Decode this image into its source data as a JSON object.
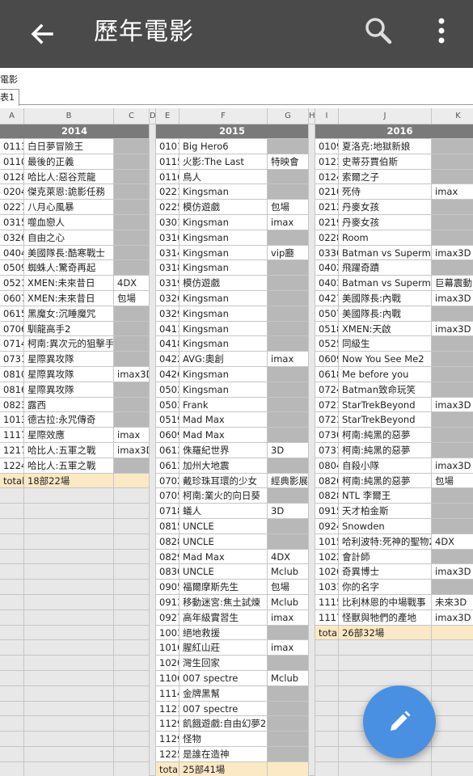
{
  "app_bar": {
    "title": "歷年電影",
    "back_icon": "arrow-left-icon",
    "search_icon": "search-icon",
    "more_icon": "more-vert-icon",
    "background": "#4a4a4a"
  },
  "sheet": {
    "name": "電影",
    "tab": "表1"
  },
  "fab": {
    "icon": "pencil-icon",
    "color": "#4a90e2"
  },
  "columns": [
    "A",
    "B",
    "C",
    "D",
    "E",
    "F",
    "G",
    "H",
    "I",
    "J",
    "K"
  ],
  "years": [
    "2014",
    "2015",
    "2016"
  ],
  "blocks": [
    {
      "rows": [
        [
          "0113",
          "白日夢冒險王",
          ""
        ],
        [
          "0110",
          "最後的正義",
          ""
        ],
        [
          "0128",
          "哈比人:惡谷荒龍",
          ""
        ],
        [
          "0204",
          "傑克萊恩:詭影任務",
          ""
        ],
        [
          "0227",
          "八月心風暴",
          ""
        ],
        [
          "0315",
          "噬血戀人",
          ""
        ],
        [
          "0326",
          "自由之心",
          ""
        ],
        [
          "0404",
          "美國隊長:酷寒戰士",
          ""
        ],
        [
          "0509",
          "蜘蛛人:驚奇再起",
          ""
        ],
        [
          "0521",
          "XMEN:未來昔日",
          "4DX"
        ],
        [
          "0607",
          "XMEN:未來昔日",
          "包場"
        ],
        [
          "0615",
          "黑魔女:沉睡魔咒",
          ""
        ],
        [
          "0706",
          "馴龍高手2",
          ""
        ],
        [
          "0714",
          "柯南:異次元的狙擊手",
          ""
        ],
        [
          "0731",
          "星際異攻隊",
          ""
        ],
        [
          "0810",
          "星際異攻隊",
          "imax3D"
        ],
        [
          "0816",
          "星際異攻隊",
          ""
        ],
        [
          "0823",
          "露西",
          ""
        ],
        [
          "1013",
          "德古拉:永咒傳奇",
          ""
        ],
        [
          "1117",
          "星際效應",
          "imax"
        ],
        [
          "1217",
          "哈比人:五軍之戰",
          "imax3D"
        ],
        [
          "1224",
          "哈比人:五軍之戰",
          ""
        ]
      ],
      "total": [
        "total",
        "18部22場",
        ""
      ]
    },
    {
      "rows": [
        [
          "0101",
          "Big Hero6",
          ""
        ],
        [
          "0115",
          "火影:The Last",
          "特映會"
        ],
        [
          "0116",
          "鳥人",
          ""
        ],
        [
          "0221",
          "Kingsman",
          ""
        ],
        [
          "0225",
          "模仿遊戲",
          "包場"
        ],
        [
          "0301",
          "Kingsman",
          "imax"
        ],
        [
          "0310",
          "Kingsman",
          ""
        ],
        [
          "0314",
          "Kingsman",
          "vip廳"
        ],
        [
          "0318",
          "Kingsman",
          ""
        ],
        [
          "0319",
          "模仿遊戲",
          ""
        ],
        [
          "0326",
          "Kingsman",
          ""
        ],
        [
          "0329",
          "Kingsman",
          ""
        ],
        [
          "0411",
          "Kingsman",
          ""
        ],
        [
          "0418",
          "Kingsman",
          ""
        ],
        [
          "0422",
          "AVG:奧創",
          "imax"
        ],
        [
          "0426",
          "Kingsman",
          ""
        ],
        [
          "0503",
          "Kingsman",
          ""
        ],
        [
          "0503",
          "Frank",
          ""
        ],
        [
          "0519",
          "Mad Max",
          ""
        ],
        [
          "0609",
          "Mad Max",
          ""
        ],
        [
          "0613",
          "侏羅紀世界",
          "3D"
        ],
        [
          "0613",
          "加州大地震",
          ""
        ],
        [
          "0702",
          "戴珍珠耳環的少女",
          "經典影展"
        ],
        [
          "0705",
          "柯南:業火的向日葵",
          ""
        ],
        [
          "0718",
          "蟻人",
          "3D"
        ],
        [
          "0815",
          "UNCLE",
          ""
        ],
        [
          "0828",
          "UNCLE",
          ""
        ],
        [
          "0829",
          "Mad Max",
          "4DX"
        ],
        [
          "0830",
          "UNCLE",
          "Mclub"
        ],
        [
          "0905",
          "福爾摩斯先生",
          "包場"
        ],
        [
          "0913",
          "移動迷宮:焦土試煉",
          "Mclub"
        ],
        [
          "0927",
          "高年級實習生",
          "imax"
        ],
        [
          "1003",
          "絕地救援",
          ""
        ],
        [
          "1016",
          "腥紅山莊",
          "imax"
        ],
        [
          "1020",
          "灣生回家",
          ""
        ],
        [
          "1106",
          "007 spectre",
          "Mclub"
        ],
        [
          "1114",
          "金牌黑幫",
          ""
        ],
        [
          "1121",
          "007 spectre",
          ""
        ],
        [
          "1129",
          "飢餓遊戲:自由幻夢2",
          ""
        ],
        [
          "1129",
          "怪物",
          ""
        ],
        [
          "1225",
          "是誰在造神",
          ""
        ]
      ],
      "total": [
        "total",
        "25部41場",
        ""
      ]
    },
    {
      "rows": [
        [
          "0109",
          "夏洛克:地獄新娘",
          ""
        ],
        [
          "0123",
          "史蒂芬賈伯斯",
          ""
        ],
        [
          "0124",
          "索爾之子",
          ""
        ],
        [
          "0210",
          "死侍",
          "imax"
        ],
        [
          "0212",
          "丹麥女孩",
          ""
        ],
        [
          "0219",
          "丹麥女孩",
          ""
        ],
        [
          "0228",
          "Room",
          ""
        ],
        [
          "0330",
          "Batman vs Superman",
          "imax3D"
        ],
        [
          "0402",
          "飛躍奇蹟",
          ""
        ],
        [
          "0403",
          "Batman vs Superman",
          "巨幕震動"
        ],
        [
          "0427",
          "美國隊長:內戰",
          "imax3D"
        ],
        [
          "0507",
          "美國隊長:內戰",
          ""
        ],
        [
          "0518",
          "XMEN:天啟",
          "imax3D"
        ],
        [
          "0525",
          "同級生",
          ""
        ],
        [
          "0609",
          "Now You See Me2",
          ""
        ],
        [
          "0618",
          "Me before you",
          ""
        ],
        [
          "0724",
          "Batman致命玩笑",
          ""
        ],
        [
          "0721",
          "StarTrekBeyond",
          "imax3D"
        ],
        [
          "0723",
          "StarTrekBeyond",
          ""
        ],
        [
          "0730",
          "柯南:純黑的惡夢",
          ""
        ],
        [
          "0731",
          "柯南:純黑的惡夢",
          ""
        ],
        [
          "0804",
          "自殺小隊",
          "imax3D"
        ],
        [
          "0820",
          "柯南:純黑的惡夢",
          "包場"
        ],
        [
          "0828",
          "NTL 李爾王",
          ""
        ],
        [
          "0915",
          "天才柏金斯",
          ""
        ],
        [
          "0924",
          "Snowden",
          ""
        ],
        [
          "1015",
          "哈利波特:死神的聖物2",
          "4DX"
        ],
        [
          "1022",
          "會計師",
          ""
        ],
        [
          "1026",
          "奇異博士",
          "imax3D"
        ],
        [
          "1031",
          "你的名字",
          ""
        ],
        [
          "1115",
          "比利林恩的中場戰事",
          "未來3D"
        ],
        [
          "1117",
          "怪獸與牠們的產地",
          "imax3D"
        ]
      ],
      "total": [
        "total",
        "26部32場",
        ""
      ]
    }
  ]
}
